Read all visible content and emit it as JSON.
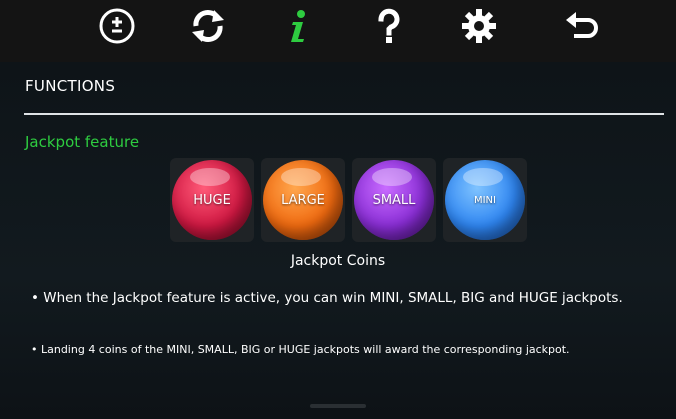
{
  "toolbar": {
    "icons": [
      {
        "name": "bet-adjust-icon",
        "color": "#ffffff"
      },
      {
        "name": "autoplay-refresh-icon",
        "color": "#ffffff"
      },
      {
        "name": "info-icon",
        "color": "#2ecc40"
      },
      {
        "name": "help-question-icon",
        "color": "#ffffff"
      },
      {
        "name": "settings-gear-icon",
        "color": "#ffffff"
      },
      {
        "name": "back-arrow-icon",
        "color": "#ffffff"
      }
    ]
  },
  "main": {
    "section_title": "FUNCTIONS",
    "feature_title": "Jackpot feature",
    "feature_title_color": "#2ecc40",
    "coins": [
      {
        "label": "HUGE",
        "color": "#d01842"
      },
      {
        "label": "LARGE",
        "color": "#f06a10"
      },
      {
        "label": "SMALL",
        "color": "#8a2ed6"
      },
      {
        "label": "MINI",
        "color": "#2f86f2"
      }
    ],
    "caption": "Jackpot Coins",
    "bullets": [
      "• When the Jackpot feature is active, you can win MINI, SMALL, BIG and HUGE jackpots.",
      "• Landing 4 coins of the MINI, SMALL, BIG or HUGE jackpots will award the corresponding jackpot."
    ]
  }
}
